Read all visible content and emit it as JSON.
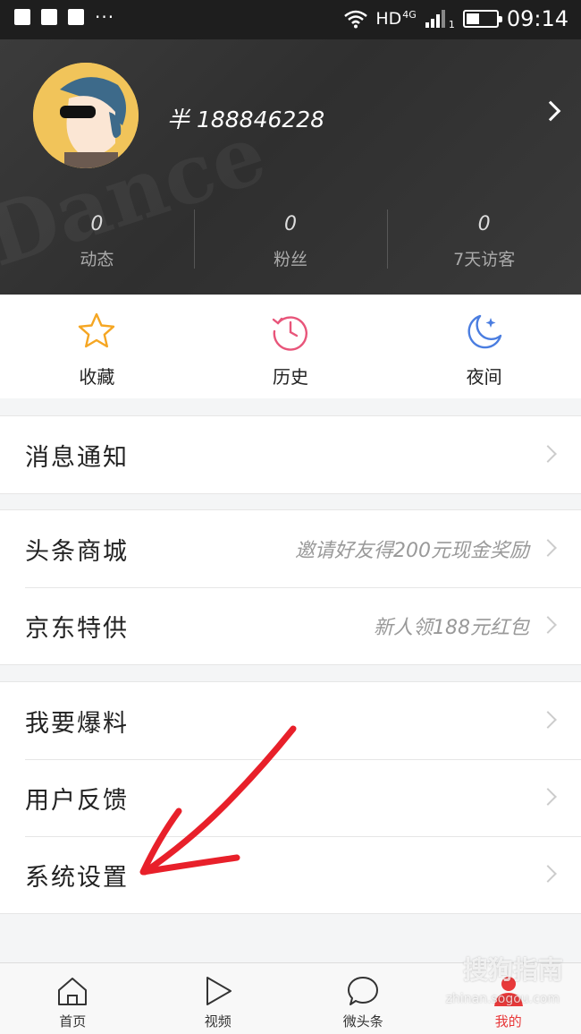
{
  "status_bar": {
    "network": "HD",
    "network_type": "4G",
    "sim_slot": "1",
    "time": "09:14",
    "battery_level": 0.45
  },
  "profile": {
    "username": "半 188846228",
    "stats": [
      {
        "value": "0",
        "label": "动态"
      },
      {
        "value": "0",
        "label": "粉丝"
      },
      {
        "value": "0",
        "label": "7天访客"
      }
    ]
  },
  "quick_actions": [
    {
      "label": "收藏",
      "icon": "star-icon",
      "color": "#f5a623"
    },
    {
      "label": "历史",
      "icon": "history-clock-icon",
      "color": "#e8557a"
    },
    {
      "label": "夜间",
      "icon": "moon-icon",
      "color": "#4a7de0"
    }
  ],
  "menu_groups": [
    {
      "rows": [
        {
          "title": "消息通知",
          "note": ""
        }
      ]
    },
    {
      "rows": [
        {
          "title": "头条商城",
          "note": "邀请好友得200元现金奖励"
        },
        {
          "title": "京东特供",
          "note": "新人领188元红包"
        }
      ]
    },
    {
      "rows": [
        {
          "title": "我要爆料",
          "note": ""
        },
        {
          "title": "用户反馈",
          "note": ""
        },
        {
          "title": "系统设置",
          "note": ""
        }
      ]
    }
  ],
  "tab_bar": [
    {
      "label": "首页",
      "icon": "home-icon",
      "active": false
    },
    {
      "label": "视频",
      "icon": "play-icon",
      "active": false
    },
    {
      "label": "微头条",
      "icon": "chat-bubble-icon",
      "active": false
    },
    {
      "label": "我的",
      "icon": "person-icon",
      "active": true
    }
  ],
  "watermark": {
    "brand": "搜狗指南",
    "url": "zhinan.sogou.com"
  },
  "colors": {
    "accent": "#e8393a",
    "annotation": "#e8202a",
    "header_bg": "#333333"
  }
}
